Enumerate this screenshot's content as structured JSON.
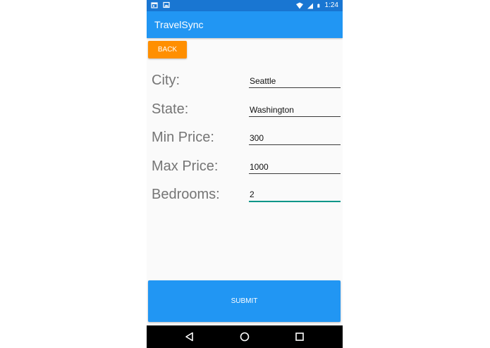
{
  "status_bar": {
    "time": "1:24",
    "left_icons": [
      "calendar-icon",
      "image-icon"
    ],
    "right_icons": [
      "wifi-icon",
      "signal-icon",
      "battery-icon"
    ],
    "color": "#1976d2"
  },
  "app_bar": {
    "title": "TravelSync",
    "color": "#2196f3"
  },
  "back_button": {
    "label": "BACK",
    "color": "#ff8f00"
  },
  "form": {
    "city": {
      "label": "City:",
      "value": "Seattle"
    },
    "state": {
      "label": "State:",
      "value": "Washington"
    },
    "min_price": {
      "label": "Min Price:",
      "value": "300"
    },
    "max_price": {
      "label": "Max Price:",
      "value": "1000"
    },
    "bedrooms": {
      "label": "Bedrooms:",
      "value": "2",
      "focused": true
    }
  },
  "submit_button": {
    "label": "SUBMIT",
    "color": "#2196f3"
  },
  "nav_bar": {
    "icons": [
      "back-triangle-icon",
      "home-circle-icon",
      "recents-square-icon"
    ]
  }
}
